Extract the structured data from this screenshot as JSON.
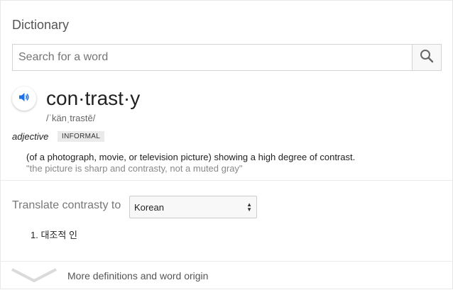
{
  "title": "Dictionary",
  "search": {
    "placeholder": "Search for a word",
    "value": ""
  },
  "entry": {
    "headword": "con·trast·y",
    "pronunciation": "/ˈkänˌtrastē/",
    "part_of_speech": "adjective",
    "label": "INFORMAL",
    "definitions": [
      {
        "number": "",
        "text": "(of a photograph, movie, or television picture) showing a high degree of contrast.",
        "example": "\"the picture is sharp and contrasty, not a muted gray\""
      }
    ]
  },
  "translate": {
    "label": "Translate contrasty to",
    "selected_language": "Korean",
    "results": [
      {
        "number": "1.",
        "text": "대조적 인"
      }
    ]
  },
  "more": {
    "label": "More definitions and word origin"
  },
  "icons": {
    "search": "search-icon",
    "speaker": "speaker-icon",
    "select": "select-caret-icon",
    "expand": "chevron-down-icon"
  },
  "colors": {
    "speaker_blue": "#1a73e8"
  }
}
